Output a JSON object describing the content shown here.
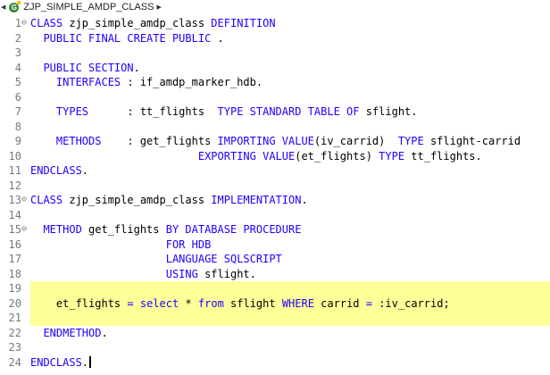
{
  "breadcrumb": {
    "label": "ZJP_SIMPLE_AMDP_CLASS",
    "class_icon_letter": "G"
  },
  "colors": {
    "keyword": "#1f00ff",
    "highlight": "#ffff99",
    "line_number": "#787878"
  },
  "editor": {
    "lines": [
      {
        "n": "1",
        "fold": "⊖",
        "tokens": [
          [
            "kw",
            "CLASS"
          ],
          [
            "t",
            " zjp_simple_amdp_class "
          ],
          [
            "kw",
            "DEFINITION"
          ]
        ]
      },
      {
        "n": "2",
        "tokens": [
          [
            "t",
            "  "
          ],
          [
            "kw",
            "PUBLIC FINAL CREATE PUBLIC"
          ],
          [
            "t",
            " ."
          ]
        ]
      },
      {
        "n": "3",
        "tokens": []
      },
      {
        "n": "4",
        "tokens": [
          [
            "t",
            "  "
          ],
          [
            "kw",
            "PUBLIC SECTION"
          ],
          [
            "t",
            "."
          ]
        ]
      },
      {
        "n": "5",
        "tokens": [
          [
            "t",
            "    "
          ],
          [
            "kw",
            "INTERFACES"
          ],
          [
            "t",
            " : if_amdp_marker_hdb."
          ]
        ]
      },
      {
        "n": "6",
        "tokens": []
      },
      {
        "n": "7",
        "tokens": [
          [
            "t",
            "    "
          ],
          [
            "kw",
            "TYPES"
          ],
          [
            "t",
            "      : tt_flights  "
          ],
          [
            "kw",
            "TYPE STANDARD TABLE OF"
          ],
          [
            "t",
            " sflight."
          ]
        ]
      },
      {
        "n": "8",
        "tokens": []
      },
      {
        "n": "9",
        "tokens": [
          [
            "t",
            "    "
          ],
          [
            "kw",
            "METHODS"
          ],
          [
            "t",
            "    : get_flights "
          ],
          [
            "kw",
            "IMPORTING VALUE"
          ],
          [
            "t",
            "(iv_carrid)  "
          ],
          [
            "kw",
            "TYPE"
          ],
          [
            "t",
            " sflight-carrid"
          ]
        ]
      },
      {
        "n": "10",
        "tokens": [
          [
            "t",
            "                          "
          ],
          [
            "kw",
            "EXPORTING VALUE"
          ],
          [
            "t",
            "(et_flights) "
          ],
          [
            "kw",
            "TYPE"
          ],
          [
            "t",
            " tt_flights."
          ]
        ]
      },
      {
        "n": "11",
        "tokens": [
          [
            "kw",
            "ENDCLASS"
          ],
          [
            "t",
            "."
          ]
        ]
      },
      {
        "n": "12",
        "tokens": []
      },
      {
        "n": "13",
        "fold": "⊖",
        "tokens": [
          [
            "kw",
            "CLASS"
          ],
          [
            "t",
            " zjp_simple_amdp_class "
          ],
          [
            "kw",
            "IMPLEMENTATION"
          ],
          [
            "t",
            "."
          ]
        ]
      },
      {
        "n": "14",
        "tokens": []
      },
      {
        "n": "15",
        "fold": "⊖",
        "tokens": [
          [
            "t",
            "  "
          ],
          [
            "kw",
            "METHOD"
          ],
          [
            "t",
            " get_flights "
          ],
          [
            "kw",
            "BY DATABASE PROCEDURE"
          ]
        ]
      },
      {
        "n": "16",
        "tokens": [
          [
            "t",
            "                     "
          ],
          [
            "kw",
            "FOR HDB"
          ]
        ]
      },
      {
        "n": "17",
        "tokens": [
          [
            "t",
            "                     "
          ],
          [
            "kw",
            "LANGUAGE SQLSCRIPT"
          ]
        ]
      },
      {
        "n": "18",
        "tokens": [
          [
            "t",
            "                     "
          ],
          [
            "kw",
            "USING"
          ],
          [
            "t",
            " sflight."
          ]
        ]
      },
      {
        "n": "19",
        "hl": true,
        "tokens": []
      },
      {
        "n": "20",
        "hl": true,
        "tokens": [
          [
            "t",
            "    et_flights "
          ],
          [
            "kw",
            "="
          ],
          [
            "t",
            " "
          ],
          [
            "kw",
            "select"
          ],
          [
            "t",
            " * "
          ],
          [
            "kw",
            "from"
          ],
          [
            "t",
            " sflight "
          ],
          [
            "kw",
            "WHERE"
          ],
          [
            "t",
            " carrid "
          ],
          [
            "kw",
            "="
          ],
          [
            "t",
            " :iv_carrid;"
          ]
        ]
      },
      {
        "n": "21",
        "hl": true,
        "tokens": []
      },
      {
        "n": "22",
        "tokens": [
          [
            "t",
            "  "
          ],
          [
            "kw",
            "ENDMETHOD"
          ],
          [
            "t",
            "."
          ]
        ]
      },
      {
        "n": "23",
        "tokens": []
      },
      {
        "n": "24",
        "cursor": true,
        "tokens": [
          [
            "kw",
            "ENDCLASS"
          ],
          [
            "t",
            "."
          ]
        ]
      }
    ]
  }
}
